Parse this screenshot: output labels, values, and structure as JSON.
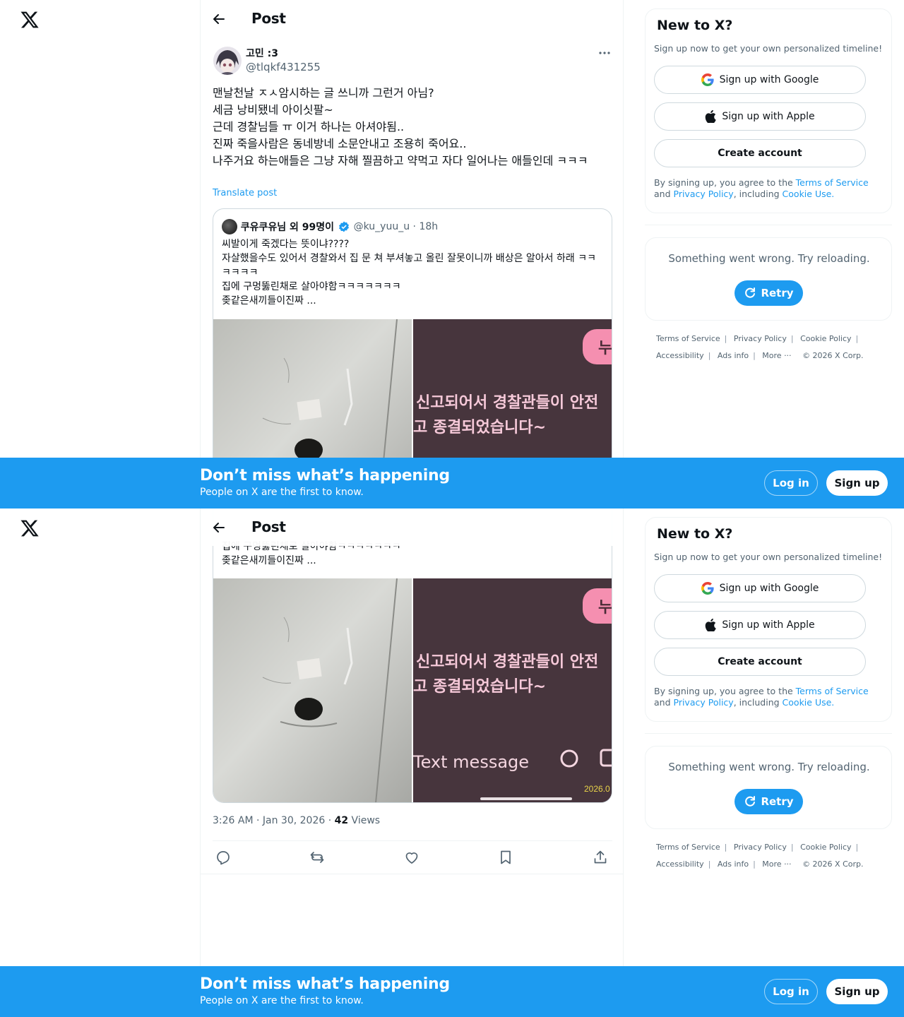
{
  "app": {
    "logo": "x-logo-icon"
  },
  "header": {
    "title": "Post",
    "back_icon": "arrow-left-icon"
  },
  "post": {
    "author_name": "고민 :3",
    "author_handle": "@tlqkf431255",
    "text": "맨날천날 ㅈㅅ암시하는 글 쓰니까 그런거 아님?\n세금 낭비됐네 아이싯팔~\n근데 경찰님들 ㅠ 이거 하나는 아셔야됨..\n진짜 죽을사람은 동네방네 소문안내고 조용히 죽어요..\n나주거요 하는애들은 그냥 자해 찔끔하고 약먹고 자다 일어나는 애들인데 ㅋㅋㅋ",
    "translate_label": "Translate post",
    "timestamp": "3:26 AM · Jan 30, 2026 · ",
    "views_count": "42",
    "views_label": " Views"
  },
  "quote": {
    "name": "쿠유쿠유님 외 99명이",
    "handle": "@ku_yuu_u",
    "age": " · 18h",
    "text": "씨발이게 죽겠다는 뜻이냐????\n자살했을수도 있어서 경찰와서 집 문 쳐 부셔놓고 올린 잘못이니까 배상은 알아서 하래 ㅋㅋㅋㅋㅋㅋ\n집에 구멍뚫린채로 살아야함ㅋㅋㅋㅋㅋㅋㅋ\n좆같은새끼들이진짜 ...",
    "text_tail": "집에 구멍뚫린채로 살아야함ㅋㅋㅋㅋㅋㅋㅋ\n좆같은새끼들이진짜 ...",
    "image_right": {
      "bubble_text": "누",
      "line1": "신고되어서 경찰관들이 안전",
      "line2": "고 종결되었습니다~",
      "input_text": "Text message",
      "date_stamp": "2026.0"
    }
  },
  "actions": [
    "reply-icon",
    "repost-icon",
    "like-icon",
    "bookmark-icon",
    "share-icon"
  ],
  "sidebar": {
    "new_title": "New to X?",
    "new_sub": "Sign up now to get your own personalized timeline!",
    "google_label": "Sign up with Google",
    "apple_label": "Sign up with Apple",
    "create_label": "Create account",
    "legal_prefix": "By signing up, you agree to the ",
    "terms": "Terms of Service",
    "and": " and ",
    "privacy": "Privacy Policy",
    "including": ", including ",
    "cookie": "Cookie Use.",
    "error_text": "Something went wrong. Try reloading.",
    "retry_label": "Retry",
    "footer": [
      "Terms of Service",
      "Privacy Policy",
      "Cookie Policy",
      "Accessibility",
      "Ads info",
      "More ···",
      "© 2026 X Corp."
    ]
  },
  "banner": {
    "title": "Don’t miss what’s happening",
    "subtitle": "People on X are the first to know.",
    "login": "Log in",
    "signup": "Sign up"
  },
  "colors": {
    "accent": "#1d9bf0",
    "text": "#0f1419",
    "muted": "#536471",
    "border": "#cfd9de"
  }
}
